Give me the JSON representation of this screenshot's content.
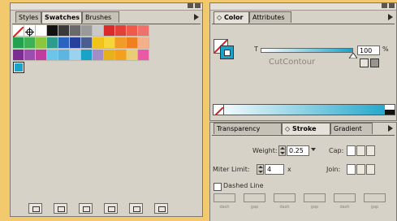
{
  "colors": {
    "desktop": "#f3c96d",
    "accent": "#1aa3c9"
  },
  "swatches_panel": {
    "tabs": [
      {
        "label": "Styles",
        "active": false
      },
      {
        "label": "Swatches",
        "active": true
      },
      {
        "label": "Brushes",
        "active": false
      }
    ],
    "swatches": [
      {
        "name": "none",
        "color": "none"
      },
      {
        "name": "registration",
        "color": "#ffffff"
      },
      {
        "name": "white",
        "color": "#ffffff"
      },
      {
        "name": "black",
        "color": "#111111"
      },
      {
        "name": "gray-1",
        "color": "#3a3a3a"
      },
      {
        "name": "gray-2",
        "color": "#6a6a6a"
      },
      {
        "name": "gray-3",
        "color": "#9a9a9a"
      },
      {
        "name": "gray-4",
        "color": "#c9c9c9"
      },
      {
        "name": "red",
        "color": "#d92b2b"
      },
      {
        "name": "red-2",
        "color": "#e3403a"
      },
      {
        "name": "salmon",
        "color": "#f05a4a"
      },
      {
        "name": "pink-red",
        "color": "#f0706b"
      },
      {
        "name": "green",
        "color": "#23a050"
      },
      {
        "name": "green-2",
        "color": "#3fb155"
      },
      {
        "name": "lime",
        "color": "#8cc63f"
      },
      {
        "name": "teal",
        "color": "#2c9d8a"
      },
      {
        "name": "blue",
        "color": "#2a63c0"
      },
      {
        "name": "navy",
        "color": "#27409b"
      },
      {
        "name": "slate",
        "color": "#4b5f8e"
      },
      {
        "name": "yellow",
        "color": "#f2c31b"
      },
      {
        "name": "yellow-2",
        "color": "#f6d639"
      },
      {
        "name": "orange",
        "color": "#f29b29"
      },
      {
        "name": "orange-2",
        "color": "#f07f20"
      },
      {
        "name": "peach",
        "color": "#f5b08a"
      },
      {
        "name": "purple",
        "color": "#7a2e91"
      },
      {
        "name": "violet",
        "color": "#9a4fb0"
      },
      {
        "name": "magenta",
        "color": "#c03c9d"
      },
      {
        "name": "light-blue",
        "color": "#6cc4e8"
      },
      {
        "name": "sky",
        "color": "#5db6e2"
      },
      {
        "name": "pale-blue",
        "color": "#9bd3ef"
      },
      {
        "name": "cyan",
        "color": "#1aa3c9"
      },
      {
        "name": "lavender",
        "color": "#a38cc7"
      },
      {
        "name": "gold",
        "color": "#e6b11b"
      },
      {
        "name": "amber",
        "color": "#f2a01d"
      },
      {
        "name": "sand",
        "color": "#e9cc74"
      },
      {
        "name": "pink",
        "color": "#e85aa6"
      },
      {
        "name": "selected-cyan",
        "color": "#1aa3c9"
      }
    ],
    "bottom_buttons": [
      {
        "name": "show-kinds-button"
      },
      {
        "name": "show-color-swatches-button"
      },
      {
        "name": "show-gradient-swatches-button"
      },
      {
        "name": "show-pattern-swatches-button"
      },
      {
        "name": "new-swatch-button"
      },
      {
        "name": "delete-swatch-button"
      }
    ]
  },
  "color_panel": {
    "tabs": [
      {
        "label": "◇ Color",
        "active": true
      },
      {
        "label": "Attributes",
        "active": false
      }
    ],
    "tint_label": "T",
    "tint_value": "100",
    "tint_unit": "%",
    "spot_name": "CutContour",
    "tint_fraction": 1.0
  },
  "stroke_panel": {
    "tabs": [
      {
        "label": "Transparency",
        "active": false
      },
      {
        "label": "◇ Stroke",
        "active": true
      },
      {
        "label": "Gradient",
        "active": false
      }
    ],
    "weight_label": "Weight:",
    "weight_value": "0.25 p",
    "cap_label": "Cap:",
    "miter_label": "Miter Limit:",
    "miter_value": "4",
    "miter_unit": "x",
    "join_label": "Join:",
    "dashed_label": "Dashed Line",
    "dash_labels": [
      "dash",
      "gap",
      "dash",
      "gap",
      "dash",
      "gap"
    ]
  }
}
